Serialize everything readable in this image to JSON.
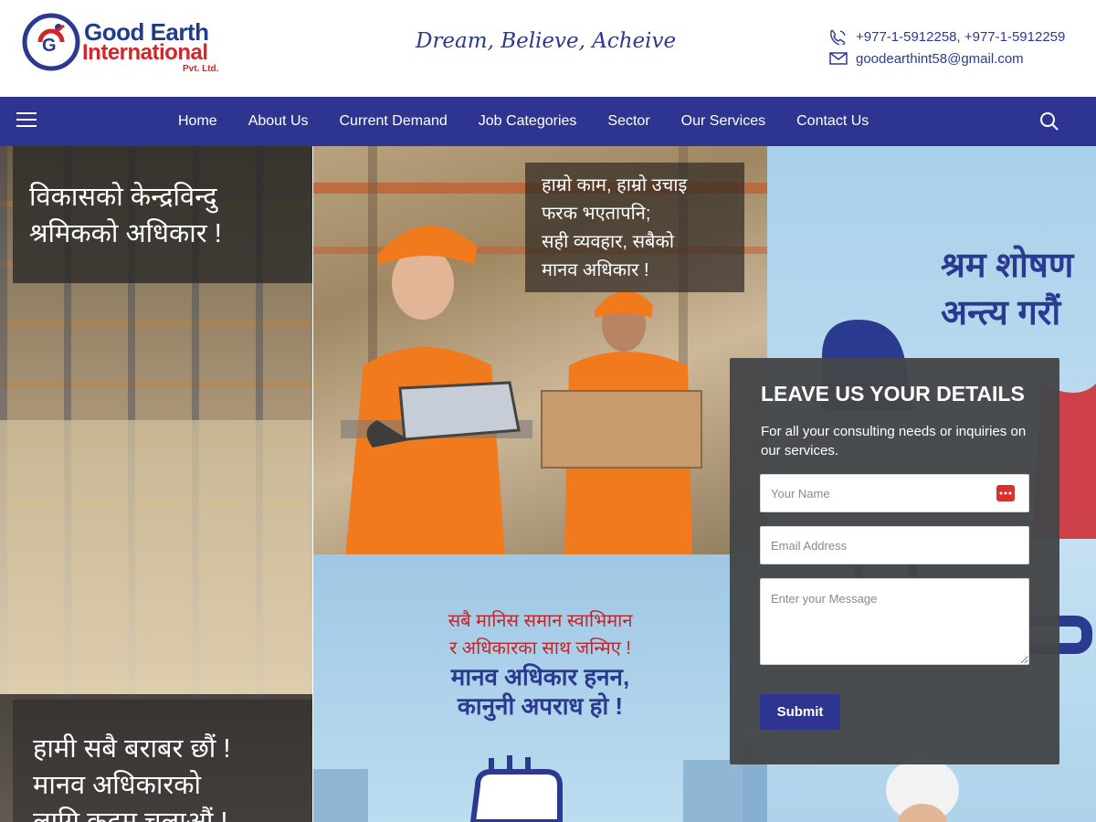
{
  "header": {
    "logo": {
      "name_line1": "Good Earth",
      "name_line2": "International",
      "suffix": "Pvt. Ltd.",
      "ring_text": "Good Earth International Pvt. Ltd."
    },
    "tagline": "Dream, Believe, Acheive",
    "phone": "+977-1-5912258, +977-1-5912259",
    "email": "goodearthint58@gmail.com"
  },
  "nav": {
    "items": [
      "Home",
      "About Us",
      "Current Demand",
      "Job Categories",
      "Sector",
      "Our Services",
      "Contact Us"
    ]
  },
  "hero": {
    "left_top_caption": [
      "विकासको केन्द्रविन्दु",
      "श्रमिकको अधिकार !"
    ],
    "left_bottom_caption": [
      "हामी सबै बराबर छौं !",
      "मानव अधिकारको",
      "लागि कदम चलाऔं !"
    ],
    "center_top_caption": [
      "हाम्रो काम, हाम्रो उचाइ",
      "फरक भएतापनि;",
      "सही व्यवहार, सबैको",
      "मानव अधिकार !"
    ],
    "center_bottom_line1": [
      "सबै मानिस समान स्वाभिमान",
      "र अधिकारका साथ जन्मिए !"
    ],
    "center_bottom_line2": [
      "मानव अधिकार हनन,",
      "कानुनी अपराध हो !"
    ],
    "right_caption": [
      "श्रम शोषण",
      "अन्त्य गरौं"
    ]
  },
  "form": {
    "title": "LEAVE US YOUR DETAILS",
    "description": "For all your consulting needs or inquiries on our services.",
    "name_placeholder": "Your Name",
    "email_placeholder": "Email Address",
    "message_placeholder": "Enter your Message",
    "submit_label": "Submit"
  },
  "colors": {
    "brand_navy": "#2e3590",
    "brand_red": "#d1262b",
    "form_bg": "#444648",
    "poster_blue": "#a9d0ea"
  },
  "icons": [
    "phone-icon",
    "mail-icon",
    "hamburger-menu-icon",
    "search-icon",
    "password-manager-icon"
  ]
}
